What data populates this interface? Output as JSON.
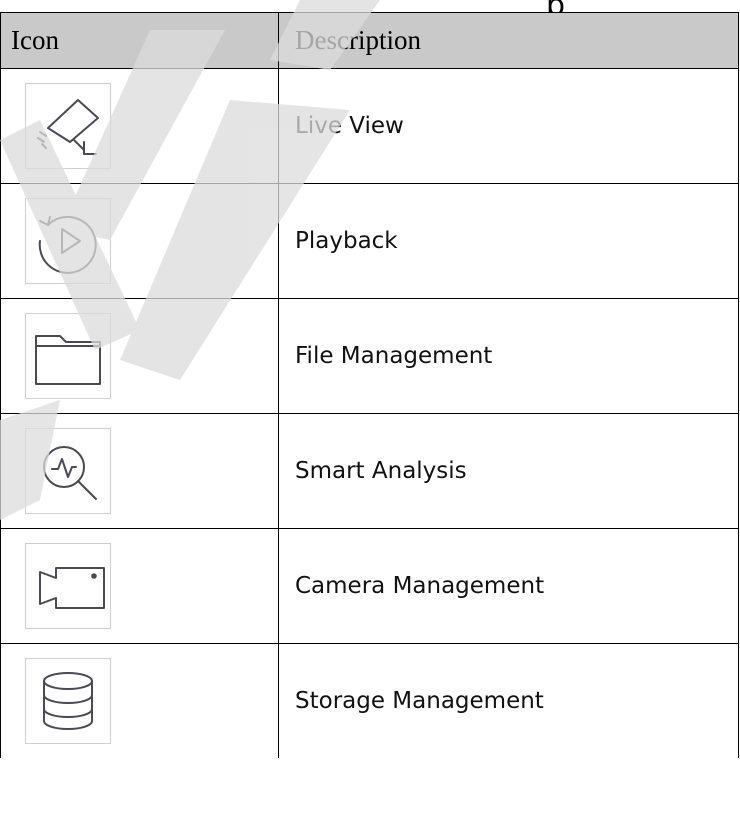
{
  "fragment_top": "p",
  "table": {
    "headers": {
      "icon": "Icon",
      "description": "Description"
    },
    "rows": [
      {
        "icon": "surveillance-camera-icon",
        "description": "Live View"
      },
      {
        "icon": "playback-icon",
        "description": "Playback"
      },
      {
        "icon": "folder-icon",
        "description": "File Management"
      },
      {
        "icon": "analysis-magnifier-icon",
        "description": "Smart Analysis"
      },
      {
        "icon": "video-camera-icon",
        "description": "Camera Management"
      },
      {
        "icon": "database-icon",
        "description": "Storage Management"
      }
    ]
  },
  "colors": {
    "header_bg": "#c9c9c9",
    "icon_stroke": "#4a4a55",
    "watermark": "#dcdcdc"
  }
}
